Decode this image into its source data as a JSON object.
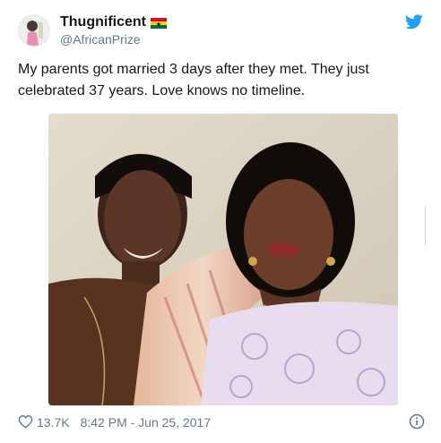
{
  "user": {
    "display_name": "Thugnificent",
    "handle": "@AfricanPrize",
    "avatar_icon": "avatar",
    "flag_icon": "ghana-flag-icon"
  },
  "tweet": {
    "text": "My parents got married 3 days after they met. They just celebrated 37 years. Love knows no timeline."
  },
  "footer": {
    "like_count": "13.7K",
    "timestamp": "8:42 PM - Jun 25, 2017"
  },
  "colors": {
    "twitter_blue": "#1da1f2",
    "secondary_text": "#657786",
    "primary_text": "#14171a",
    "flag_red": "#ce1126",
    "flag_gold": "#fcd116",
    "flag_green": "#006b3f"
  },
  "icons": {
    "brand": "twitter-bird-icon",
    "like": "heart-icon",
    "info": "info-icon"
  }
}
